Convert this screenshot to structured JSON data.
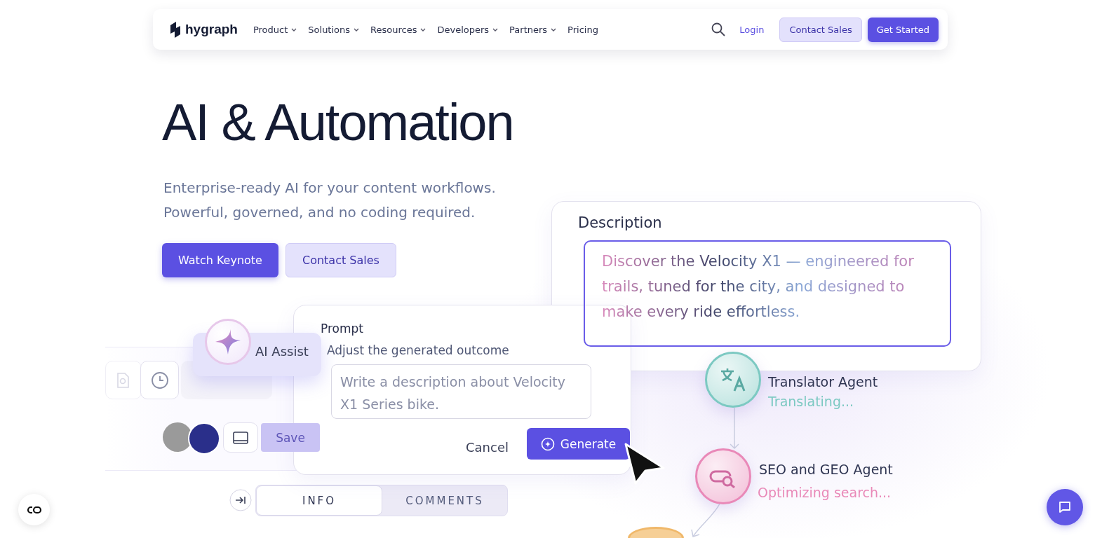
{
  "nav": {
    "logo": "hygraph",
    "items": [
      {
        "label": "Product",
        "dropdown": true
      },
      {
        "label": "Solutions",
        "dropdown": true
      },
      {
        "label": "Resources",
        "dropdown": true
      },
      {
        "label": "Developers",
        "dropdown": true
      },
      {
        "label": "Partners",
        "dropdown": true
      },
      {
        "label": "Pricing",
        "dropdown": false
      }
    ],
    "login": "Login",
    "contact_sales": "Contact Sales",
    "get_started": "Get Started"
  },
  "hero": {
    "title": "AI & Automation",
    "subtitle_lines": [
      "Enterprise-ready AI for your content workflows.",
      "Powerful, governed, and no coding required."
    ],
    "buttons": [
      {
        "label": "Watch Keynote",
        "kind": "primary"
      },
      {
        "label": "Contact Sales",
        "kind": "secondary"
      }
    ]
  },
  "illustration": {
    "editor": {
      "save": {
        "label": "Save",
        "disabled": true
      },
      "tabs": [
        {
          "label": "INFO",
          "selected": true
        },
        {
          "label": "COMMENTS",
          "selected": false
        }
      ]
    },
    "ai_assist": "AI Assist",
    "prompt": {
      "title": "Prompt",
      "hint": "Adjust the generated outcome",
      "placeholder": "Write a description about Velocity X1 Series bike.",
      "cancel": "Cancel",
      "generate": "Generate"
    },
    "description": {
      "label": "Description",
      "text": "Discover the Velocity X1 — engineered for trails, tuned for the city, and designed to make every ride effortless."
    },
    "agents": [
      {
        "name": "Translator Agent",
        "status": "Translating...",
        "color": "#7cc9c2",
        "kind": "translate"
      },
      {
        "name": "SEO and GEO Agent",
        "status": "Optimizing search...",
        "color": "#e989b8",
        "kind": "search"
      }
    ]
  }
}
